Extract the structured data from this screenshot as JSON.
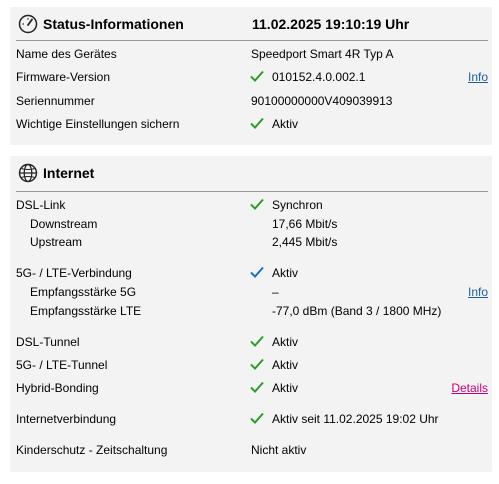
{
  "status": {
    "title": "Status-Informationen",
    "datetime": "11.02.2025 19:10:19 Uhr",
    "rows": [
      {
        "label": "Name des Gerätes",
        "value": "Speedport Smart 4R Typ A"
      },
      {
        "label": "Firmware-Version",
        "value": "010152.4.0.002.1",
        "link": "Info"
      },
      {
        "label": "Seriennummer",
        "value": "90100000000V409039913"
      },
      {
        "label": "Wichtige Einstellungen sichern",
        "value": "Aktiv"
      }
    ]
  },
  "internet": {
    "title": "Internet",
    "rows": [
      {
        "label": "DSL-Link",
        "value": "Synchron"
      },
      {
        "label": "Downstream",
        "value": "17,66 Mbit/s"
      },
      {
        "label": "Upstream",
        "value": "2,445 Mbit/s"
      },
      {
        "label": "5G- / LTE-Verbindung",
        "value": "Aktiv"
      },
      {
        "label": "Empfangsstärke 5G",
        "value": "–",
        "link": "Info"
      },
      {
        "label": "Empfangsstärke LTE",
        "value": "-77,0 dBm (Band 3 / 1800 MHz)"
      },
      {
        "label": "DSL-Tunnel",
        "value": "Aktiv"
      },
      {
        "label": "5G- / LTE-Tunnel",
        "value": "Aktiv"
      },
      {
        "label": "Hybrid-Bonding",
        "value": "Aktiv",
        "link": "Details"
      },
      {
        "label": "Internetverbindung",
        "value": "Aktiv seit 11.02.2025 19:02 Uhr"
      },
      {
        "label": "Kinderschutz - Zeitschaltung",
        "value": "Nicht aktiv"
      }
    ]
  },
  "icons": {
    "status": "gauge-icon",
    "internet": "globe-icon",
    "check_green": "check-green-icon",
    "check_blue": "check-blue-icon"
  },
  "colors": {
    "check_green": "#2e9a2e",
    "check_blue": "#1d6fc0",
    "link_blue": "#1f5fa0",
    "link_magenta": "#c8007a",
    "panel_bg": "#f3f3f3"
  }
}
